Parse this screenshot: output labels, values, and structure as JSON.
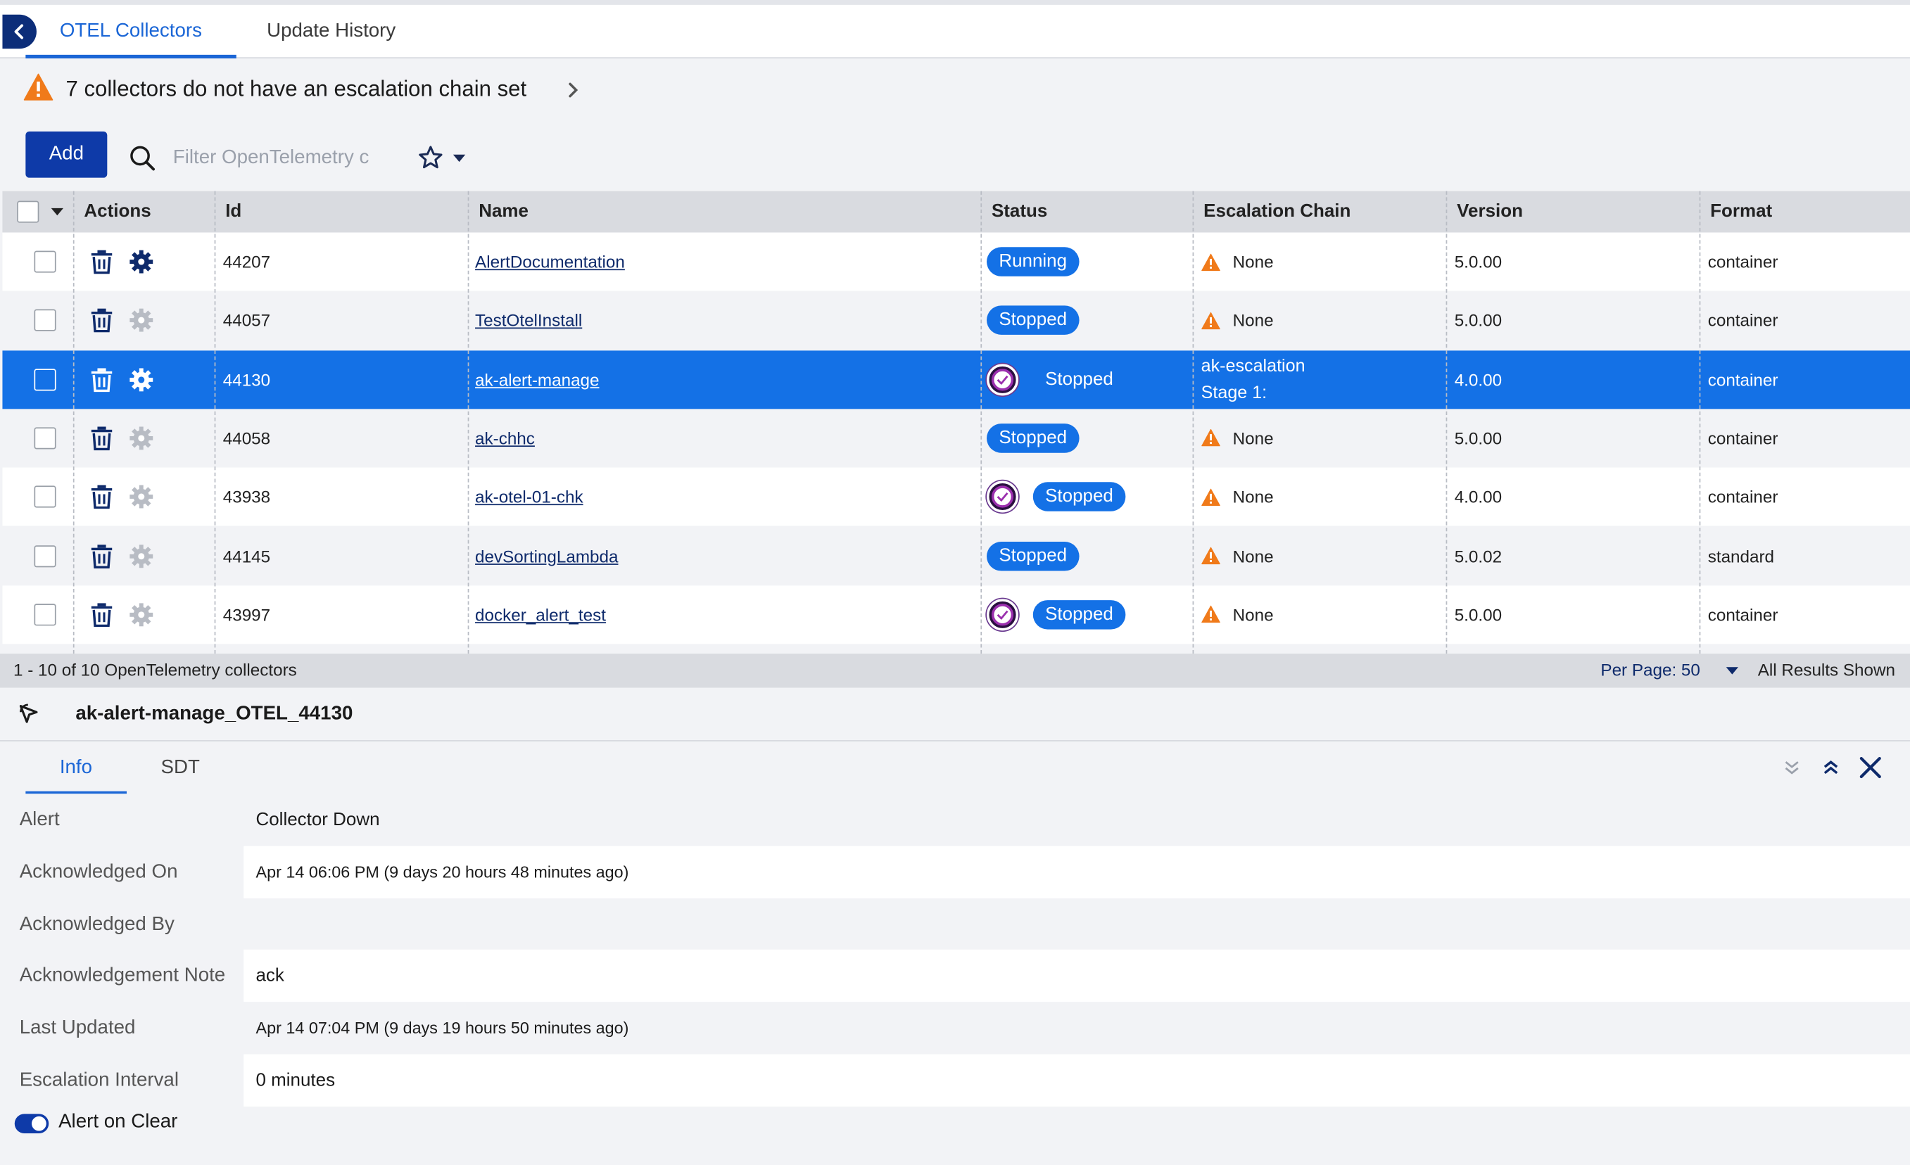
{
  "tabs": {
    "collectors": "OTEL Collectors",
    "history": "Update History"
  },
  "warning": {
    "text": "7 collectors do not have an escalation chain set"
  },
  "toolbar": {
    "add_label": "Add",
    "search_placeholder": "Filter OpenTelemetry c"
  },
  "table": {
    "headers": {
      "actions": "Actions",
      "id": "Id",
      "name": "Name",
      "status": "Status",
      "escalation": "Escalation Chain",
      "version": "Version",
      "format": "Format"
    },
    "rows": [
      {
        "id": "44207",
        "name": "AlertDocumentation",
        "status": "Running",
        "ack": false,
        "escalation": "None",
        "escalation_line2": "",
        "version": "5.0.00",
        "format": "container",
        "settings_active": true
      },
      {
        "id": "44057",
        "name": "TestOtelInstall",
        "status": "Stopped",
        "ack": false,
        "escalation": "None",
        "escalation_line2": "",
        "version": "5.0.00",
        "format": "container",
        "settings_active": false
      },
      {
        "id": "44130",
        "name": "ak-alert-manage",
        "status": "Stopped",
        "ack": true,
        "escalation": "ak-escalation",
        "escalation_line2": "Stage 1:",
        "version": "4.0.00",
        "format": "container",
        "settings_active": true,
        "selected": true
      },
      {
        "id": "44058",
        "name": "ak-chhc",
        "status": "Stopped",
        "ack": false,
        "escalation": "None",
        "escalation_line2": "",
        "version": "5.0.00",
        "format": "container",
        "settings_active": false
      },
      {
        "id": "43938",
        "name": "ak-otel-01-chk",
        "status": "Stopped",
        "ack": true,
        "escalation": "None",
        "escalation_line2": "",
        "version": "4.0.00",
        "format": "container",
        "settings_active": false
      },
      {
        "id": "44145",
        "name": "devSortingLambda",
        "status": "Stopped",
        "ack": false,
        "escalation": "None",
        "escalation_line2": "",
        "version": "5.0.02",
        "format": "standard",
        "settings_active": false
      },
      {
        "id": "43997",
        "name": "docker_alert_test",
        "status": "Stopped",
        "ack": true,
        "escalation": "None",
        "escalation_line2": "",
        "version": "5.0.00",
        "format": "container",
        "settings_active": false
      }
    ]
  },
  "footer": {
    "range": "1 - 10 of 10 OpenTelemetry collectors",
    "per_page": "Per Page: 50",
    "all_results": "All Results Shown"
  },
  "detail": {
    "title": "ak-alert-manage_OTEL_44130",
    "tabs": {
      "info": "Info",
      "sdt": "SDT"
    },
    "fields": [
      {
        "label": "Alert",
        "value": "Collector Down"
      },
      {
        "label": "Acknowledged On",
        "value": "Apr 14 06:06 PM  (9 days 20 hours 48 minutes ago)"
      },
      {
        "label": "Acknowledged By",
        "value": ""
      },
      {
        "label": "Acknowledgement Note",
        "value": "ack"
      },
      {
        "label": "Last Updated",
        "value": "Apr 14 07:04 PM  (9 days 19 hours 50 minutes ago)"
      },
      {
        "label": "Escalation Interval",
        "value": "0 minutes"
      }
    ],
    "alert_on_clear": "Alert on Clear",
    "alert_on_clear_enabled": true
  },
  "colors": {
    "accent": "#1471e6",
    "primary_button": "#0e3aa8",
    "warning": "#f07a1a",
    "ack_ring": "#9b2fae"
  },
  "icons": {
    "back": "chevron-left-icon",
    "warning": "warning-triangle-icon",
    "search": "search-icon",
    "star": "star-icon",
    "trash": "trash-icon",
    "settings": "gear-icon",
    "ack": "acknowledged-check-icon",
    "close": "close-icon",
    "expand": "chevron-double-down-icon",
    "collapse": "chevron-double-up-icon",
    "locate": "locate-pointer-icon"
  }
}
